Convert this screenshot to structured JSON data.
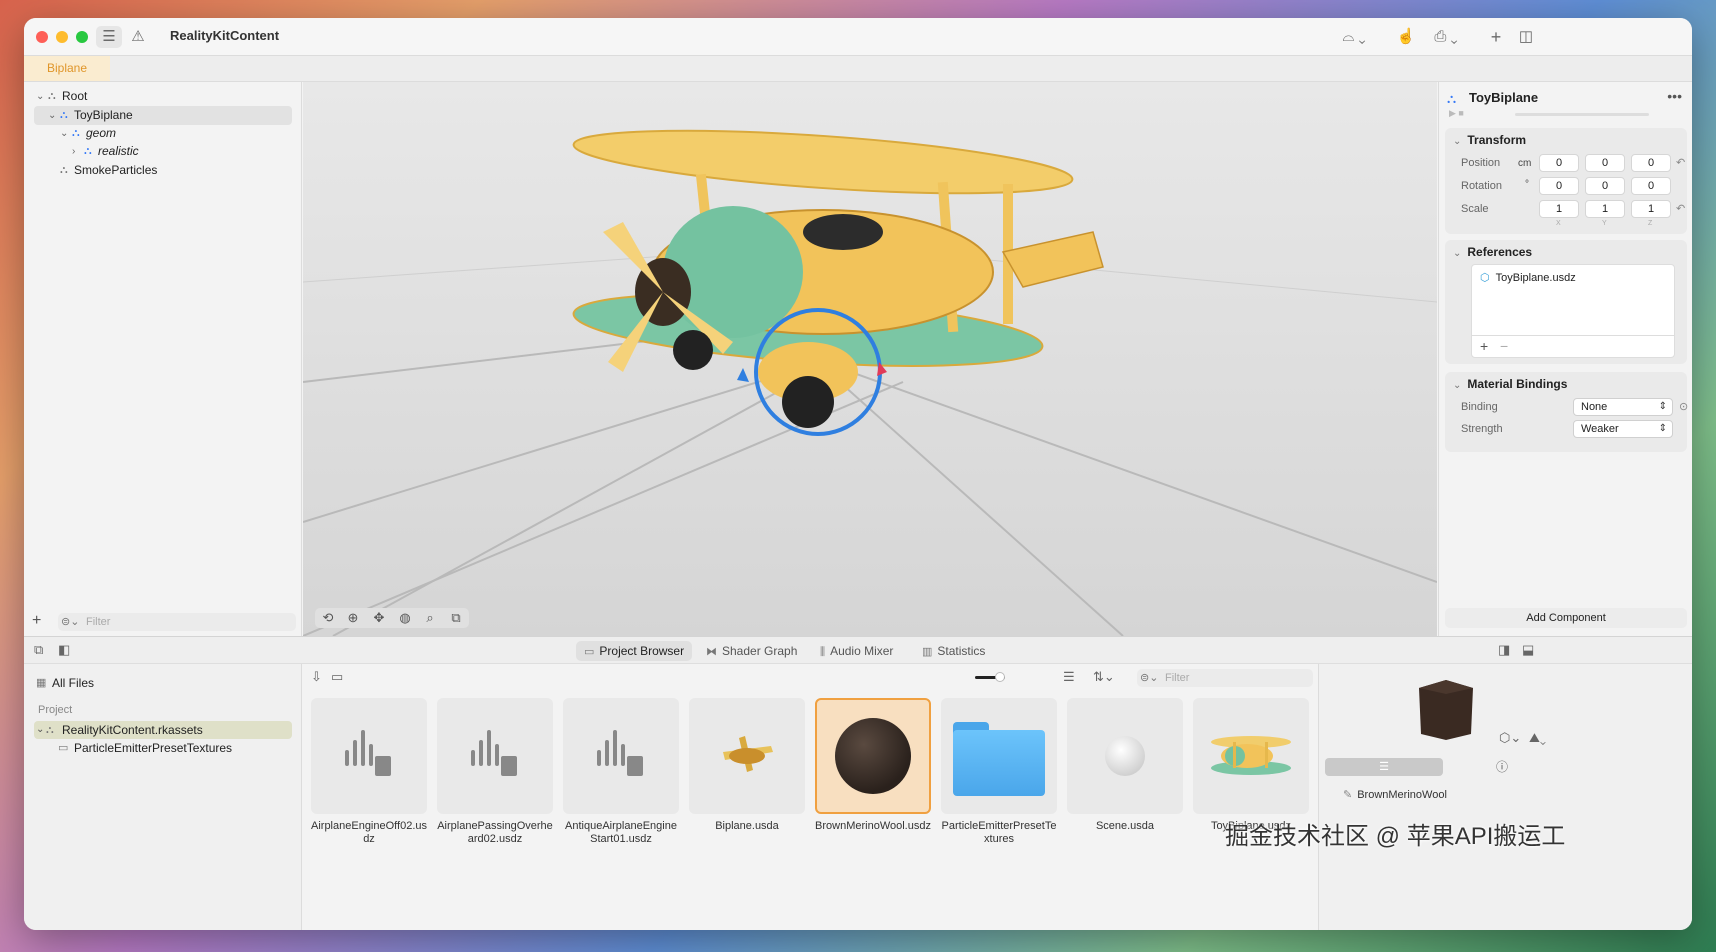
{
  "window": {
    "title": "RealityKitContent"
  },
  "tabs": [
    {
      "label": "Biplane"
    }
  ],
  "outline": {
    "items": [
      {
        "label": "Root"
      },
      {
        "label": "ToyBiplane"
      },
      {
        "label": "geom"
      },
      {
        "label": "realistic"
      },
      {
        "label": "SmokeParticles"
      }
    ],
    "filter_placeholder": "Filter"
  },
  "inspector": {
    "entity_name": "ToyBiplane",
    "transform": {
      "title": "Transform",
      "position_label": "Position",
      "position_unit": "cm",
      "position": [
        "0",
        "0",
        "0"
      ],
      "rotation_label": "Rotation",
      "rotation_unit": "°",
      "rotation": [
        "0",
        "0",
        "0"
      ],
      "scale_label": "Scale",
      "scale": [
        "1",
        "1",
        "1"
      ],
      "axes": [
        "X",
        "Y",
        "Z"
      ]
    },
    "references": {
      "title": "References",
      "items": [
        "ToyBiplane.usdz"
      ]
    },
    "material_bindings": {
      "title": "Material Bindings",
      "binding_label": "Binding",
      "binding_value": "None",
      "strength_label": "Strength",
      "strength_value": "Weaker"
    },
    "add_component": "Add Component"
  },
  "bottom_tabs": [
    "Project Browser",
    "Shader Graph",
    "Audio Mixer",
    "Statistics"
  ],
  "files_sidebar": {
    "all_files": "All Files",
    "section": "Project",
    "items": [
      "RealityKitContent.rkassets",
      "ParticleEmitterPresetTextures"
    ]
  },
  "files_filter_placeholder": "Filter",
  "assets": [
    {
      "name": "AirplaneEngineOff02.usdz"
    },
    {
      "name": "AirplanePassingOverheard02.usdz"
    },
    {
      "name": "AntiqueAirplaneEngineStart01.usdz"
    },
    {
      "name": "Biplane.usda"
    },
    {
      "name": "BrownMerinoWool.usdz"
    },
    {
      "name": "ParticleEmitterPresetTextures"
    },
    {
      "name": "Scene.usda"
    },
    {
      "name": "ToyBiplane.usdz"
    }
  ],
  "preview": {
    "selected_name": "BrownMerinoWool"
  },
  "watermark": "掘金技术社区 @ 苹果API搬运工",
  "colors": {
    "accent": "#f0a040",
    "selection_blue": "#3478f6"
  }
}
